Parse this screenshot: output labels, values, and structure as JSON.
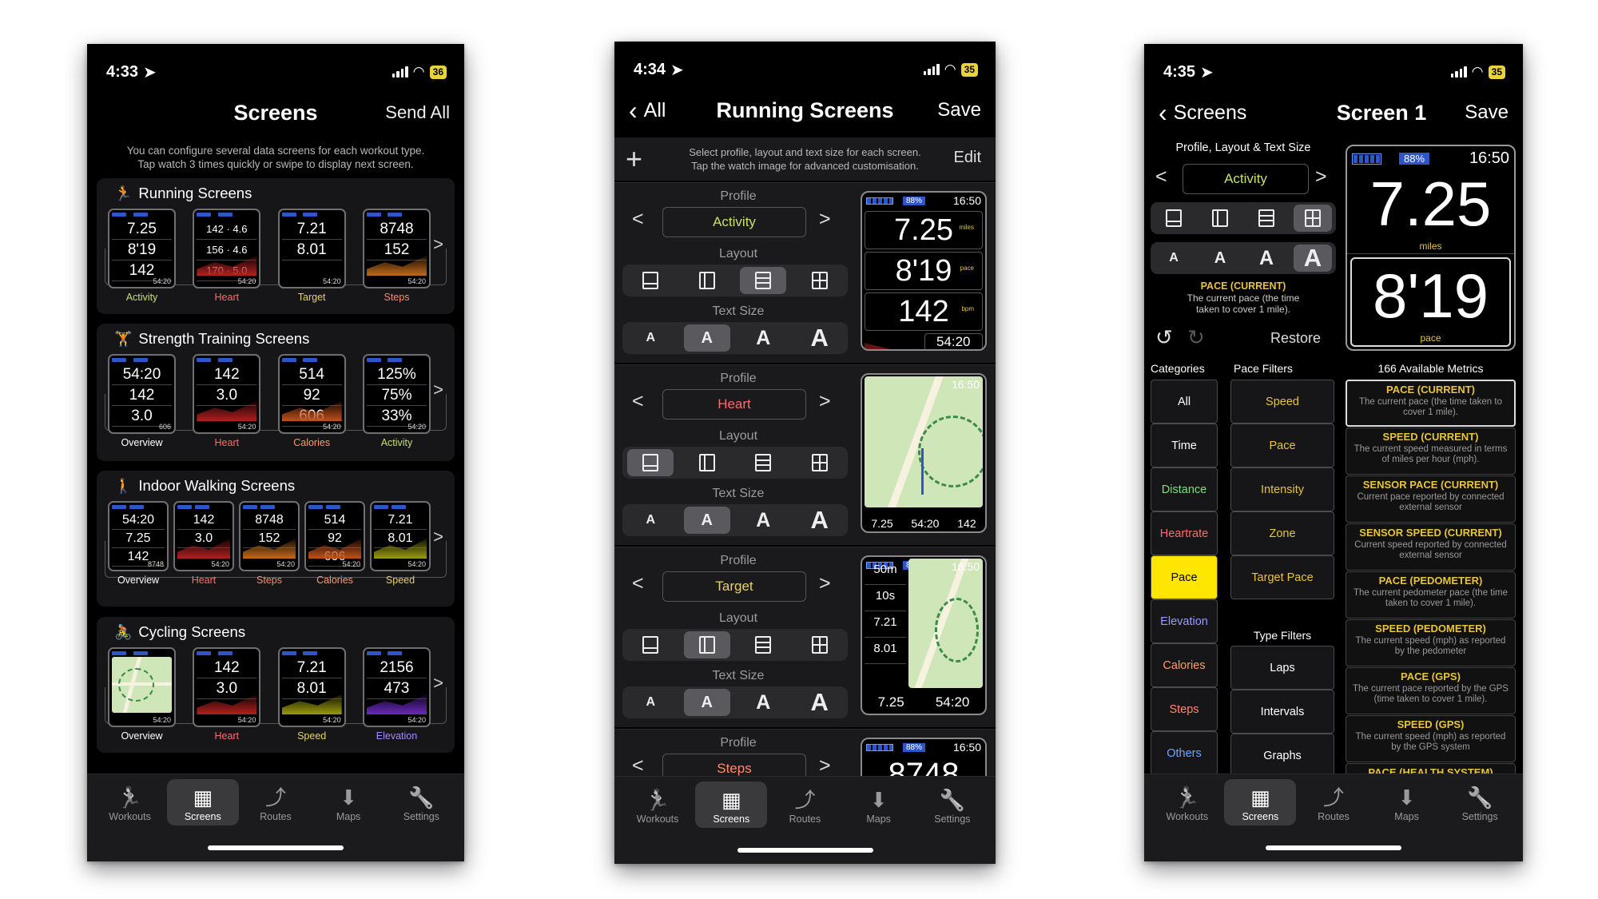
{
  "phone1": {
    "status": {
      "time": "4:33",
      "battery": "36"
    },
    "nav": {
      "title": "Screens",
      "right": "Send All"
    },
    "hint": "You can configure several data screens for each workout type.\nTap watch 3 times quickly or swipe to display next screen.",
    "sections": [
      {
        "title": "Running Screens",
        "icon": "running-icon",
        "thumbs": [
          {
            "label": "Activity",
            "color": "#c8e06a",
            "rows": [
              "7.25",
              "8'19",
              "142"
            ],
            "foot": "54:20"
          },
          {
            "label": "Heart",
            "color": "#ff6b6b",
            "rows": [
              "142 · 4.6",
              "156 · 4.6",
              "170 · 5.0"
            ],
            "foot": "54:20"
          },
          {
            "label": "Target",
            "color": "#e8d06a",
            "rows": [
              "7.21",
              "8.01"
            ],
            "foot": "54:20"
          },
          {
            "label": "Steps",
            "color": "#ff8a6b",
            "rows": [
              "8748",
              "152"
            ],
            "foot": "54:20"
          }
        ]
      },
      {
        "title": "Strength Training Screens",
        "icon": "strength-icon",
        "thumbs": [
          {
            "label": "Overview",
            "color": "#ffffff",
            "rows": [
              "54:20",
              "142",
              "3.0"
            ],
            "foot": "606"
          },
          {
            "label": "Heart",
            "color": "#ff6b6b",
            "rows": [
              "142",
              "3.0"
            ],
            "foot": "54:20"
          },
          {
            "label": "Calories",
            "color": "#ff9a6b",
            "rows": [
              "514",
              "92",
              "606"
            ],
            "foot": "54:20"
          },
          {
            "label": "Activity",
            "color": "#c8e06a",
            "rows": [
              "125%",
              "75%",
              "33%"
            ],
            "foot": "54:20"
          }
        ]
      },
      {
        "title": "Indoor Walking Screens",
        "icon": "walking-icon",
        "thumbs": [
          {
            "label": "Overview",
            "color": "#ffffff",
            "rows": [
              "54:20",
              "7.25",
              "142"
            ],
            "foot": "8748"
          },
          {
            "label": "Heart",
            "color": "#ff6b6b",
            "rows": [
              "142",
              "3.0"
            ],
            "foot": "54:20"
          },
          {
            "label": "Steps",
            "color": "#ff8a6b",
            "rows": [
              "8748",
              "152"
            ],
            "foot": "54:20"
          },
          {
            "label": "Calories",
            "color": "#ff9a6b",
            "rows": [
              "514",
              "92",
              "606"
            ],
            "foot": "54:20"
          },
          {
            "label": "Speed",
            "color": "#e8d06a",
            "rows": [
              "7.21",
              "8.01"
            ],
            "foot": "54:20"
          }
        ]
      },
      {
        "title": "Cycling Screens",
        "icon": "cycling-icon",
        "thumbs": [
          {
            "label": "Overview",
            "color": "#ffffff",
            "rows": [],
            "foot": "54:20"
          },
          {
            "label": "Heart",
            "color": "#ff6b6b",
            "rows": [
              "142",
              "3.0"
            ],
            "foot": "54:20"
          },
          {
            "label": "Speed",
            "color": "#e8d06a",
            "rows": [
              "7.21",
              "8.01"
            ],
            "foot": "54:20"
          },
          {
            "label": "Elevation",
            "color": "#a98aff",
            "rows": [
              "2156",
              "473"
            ],
            "foot": "54:20"
          }
        ]
      }
    ]
  },
  "phone2": {
    "status": {
      "time": "4:34",
      "battery": "35"
    },
    "nav": {
      "back": "All",
      "title": "Running Screens",
      "right": "Save"
    },
    "hint": "Select profile, layout and text size for each screen.\nTap the watch image for advanced customisation.",
    "edit": "Edit",
    "labels": {
      "profile": "Profile",
      "layout": "Layout",
      "text_size": "Text Size"
    },
    "blocks": [
      {
        "profile": "Activity",
        "color": "#c8e06a",
        "layout_on": 2,
        "text_on": 1,
        "watch": {
          "top": "16:50",
          "rows": [
            "7.25",
            "8'19",
            "142"
          ],
          "units": [
            "miles",
            "pace",
            "bpm"
          ],
          "foot": "54:20"
        }
      },
      {
        "profile": "Heart",
        "color": "#ff6b6b",
        "layout_on": 0,
        "text_on": 1,
        "watch": {
          "top": "16:50",
          "foot_left": "7.25",
          "foot_mid": "54:20",
          "foot_right": "142"
        }
      },
      {
        "profile": "Target",
        "color": "#e8d06a",
        "layout_on": 1,
        "text_on": 1,
        "watch": {
          "top": "16:50",
          "rows": [
            "50m",
            "10s",
            "7.21",
            "8.01"
          ],
          "foot_left": "7.25",
          "foot_right": "54:20"
        }
      },
      {
        "profile": "Steps",
        "color": "#ff8a6b",
        "layout_on": 0,
        "text_on": 1,
        "watch": {
          "top": "16:50",
          "rows": [
            "8748"
          ]
        }
      }
    ]
  },
  "phone3": {
    "status": {
      "time": "4:35",
      "battery": "35"
    },
    "nav": {
      "back": "Screens",
      "title": "Screen 1",
      "right": "Save"
    },
    "section_title": "Profile, Layout & Text Size",
    "profile": "Activity",
    "pace_title": "PACE (CURRENT)",
    "pace_desc": "The current pace (the time taken to cover 1 mile).",
    "restore": "Restore",
    "watch": {
      "battery": "88%",
      "time": "16:50",
      "value1": "7.25",
      "unit1": "miles",
      "value2": "8'19",
      "unit2": "pace"
    },
    "headers": {
      "categories": "Categories",
      "pace_filters": "Pace Filters",
      "type_filters": "Type Filters",
      "metrics": "166 Available Metrics"
    },
    "categories": [
      {
        "label": "All",
        "color": "#ffffff"
      },
      {
        "label": "Time",
        "color": "#ffffff"
      },
      {
        "label": "Distance",
        "color": "#7ee07e"
      },
      {
        "label": "Heartrate",
        "color": "#ff6b6b"
      },
      {
        "label": "Pace",
        "color": "#000000"
      },
      {
        "label": "Elevation",
        "color": "#9a9aff"
      },
      {
        "label": "Calories",
        "color": "#ff9a6b"
      },
      {
        "label": "Steps",
        "color": "#ff8a6b"
      },
      {
        "label": "Others",
        "color": "#6aa8ff"
      }
    ],
    "pace_filters": [
      "Speed",
      "Pace",
      "Intensity",
      "Zone",
      "Target Pace"
    ],
    "type_filters": [
      "Laps",
      "Intervals",
      "Graphs"
    ],
    "metrics": [
      {
        "title": "PACE (CURRENT)",
        "desc": "The current pace (the time taken to cover 1 mile)."
      },
      {
        "title": "SPEED (CURRENT)",
        "desc": "The current speed measured in terms of miles per hour (mph)."
      },
      {
        "title": "SENSOR PACE (CURRENT)",
        "desc": "Current pace reported by connected external sensor"
      },
      {
        "title": "SENSOR SPEED (CURRENT)",
        "desc": "Current speed reported by connected external sensor"
      },
      {
        "title": "PACE (PEDOMETER)",
        "desc": "The current pedometer pace (the time taken to cover 1 mile)."
      },
      {
        "title": "SPEED (PEDOMETER)",
        "desc": "The current speed (mph) as reported by the pedometer"
      },
      {
        "title": "PACE (GPS)",
        "desc": "The current pace reported by the GPS (time taken to cover 1 mile)."
      },
      {
        "title": "SPEED (GPS)",
        "desc": "The current speed (mph) as reported by the GPS system"
      },
      {
        "title": "PACE (HEALTH SYSTEM)",
        "desc": ""
      }
    ]
  },
  "tabs": [
    "Workouts",
    "Screens",
    "Routes",
    "Maps",
    "Settings"
  ],
  "colors": {
    "pace_highlight": "#ffe600",
    "accent_yellow": "#e8c43a",
    "watch_blue": "#2e56c9"
  }
}
